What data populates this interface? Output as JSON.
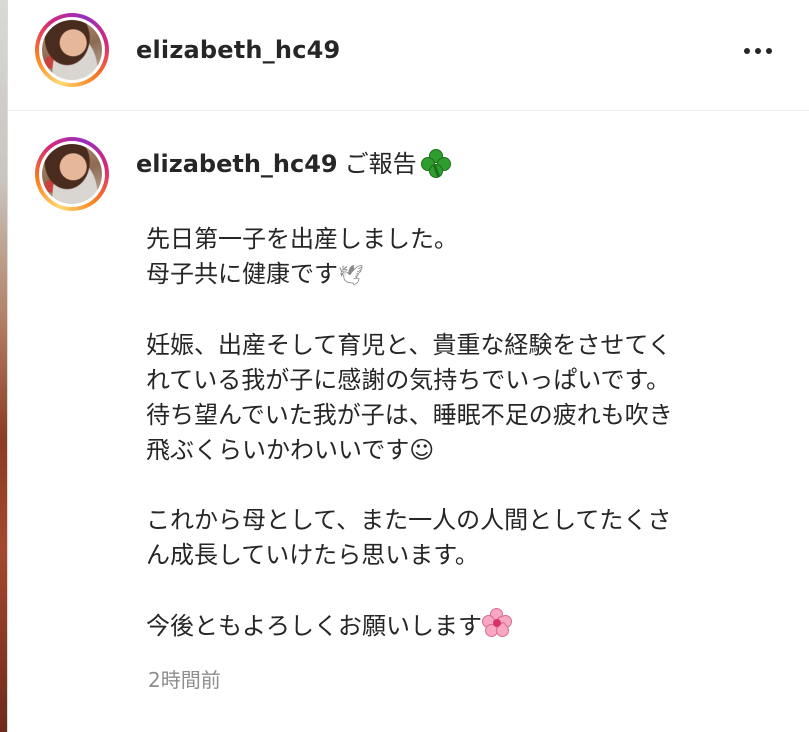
{
  "post": {
    "username": "elizabeth_hc49"
  },
  "comment": {
    "username": "elizabeth_hc49",
    "heading": "ご報告",
    "heading_icon": "four-leaf-clover-icon",
    "lines": [
      "先日第一子を出産しました。",
      "母子共に健康です",
      "",
      "妊娠、出産そして育児と、貴重な経験をさせてく",
      "れている我が子に感謝の気持ちでいっぱいです。",
      "待ち望んでいた我が子は、睡眠不足の疲れも吹き",
      "飛ぶくらいかわいいです☺",
      "",
      "これから母として、また一人の人間としてたくさ",
      "ん成長していけたら思います。",
      "",
      "今後ともよろしくお願いします"
    ],
    "inline_glyph_line2": "🕊",
    "closing_icon": "cherry-blossom-icon",
    "timestamp": "2時間前"
  },
  "icons": {
    "more": "more-options-icon"
  },
  "colors": {
    "text": "#262626",
    "muted": "#8e8e8e",
    "ring_start": "#feda75",
    "ring_mid": "#d62976",
    "ring_end": "#962fbf"
  }
}
